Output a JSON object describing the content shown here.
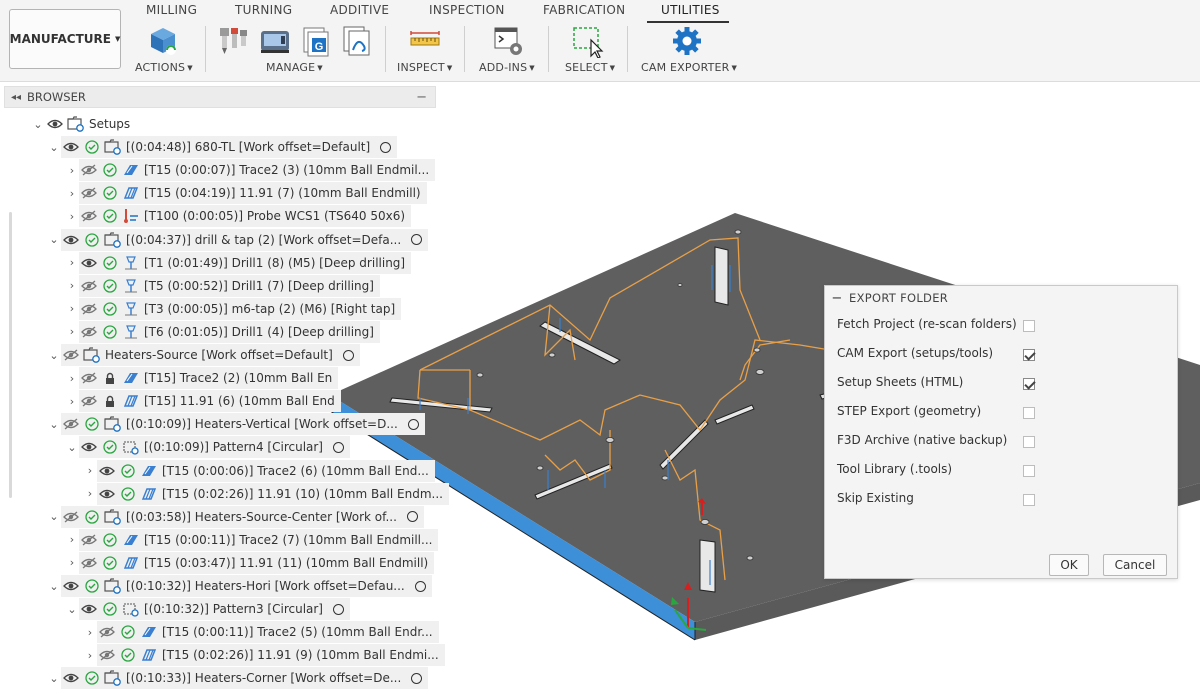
{
  "ribbon": {
    "workspace": "MANUFACTURE",
    "tabs": [
      "MILLING",
      "TURNING",
      "ADDITIVE",
      "INSPECTION",
      "FABRICATION",
      "UTILITIES"
    ],
    "active_tab": "UTILITIES",
    "groups": {
      "actions": "ACTIONS",
      "manage": "MANAGE",
      "inspect": "INSPECT",
      "addins": "ADD-INS",
      "select": "SELECT",
      "cam_exporter": "CAM EXPORTER"
    },
    "accent": "#1f73c4"
  },
  "browser": {
    "title": "BROWSER",
    "rows": [
      {
        "label": "Setups"
      },
      {
        "label": "[(0:04:48)] 680-TL [Work offset=Default]"
      },
      {
        "label": "[T15 (0:00:07)] Trace2 (3) (10mm Ball Endmil..."
      },
      {
        "label": "[T15 (0:04:19)] 11.91 (7) (10mm Ball Endmill)"
      },
      {
        "label": "[T100 (0:00:05)] Probe WCS1 (TS640 50x6)"
      },
      {
        "label": "[(0:04:37)] drill & tap (2) [Work offset=Defa..."
      },
      {
        "label": "[T1 (0:01:49)] Drill1 (8) (M5) [Deep drilling]"
      },
      {
        "label": "[T5 (0:00:52)] Drill1 (7) [Deep drilling]"
      },
      {
        "label": "[T3 (0:00:05)] m6-tap (2) (M6) [Right tap]"
      },
      {
        "label": "[T6 (0:01:05)] Drill1 (4) [Deep drilling]"
      },
      {
        "label": "Heaters-Source [Work offset=Default]"
      },
      {
        "label": "[T15] Trace2 (2) (10mm Ball En"
      },
      {
        "label": "[T15] 11.91 (6) (10mm Ball End"
      },
      {
        "label": "[(0:10:09)] Heaters-Vertical [Work offset=D..."
      },
      {
        "label": "[(0:10:09)] Pattern4 [Circular]"
      },
      {
        "label": "[T15 (0:00:06)] Trace2 (6) (10mm Ball End..."
      },
      {
        "label": "[T15 (0:02:26)] 11.91 (10) (10mm Ball Endm..."
      },
      {
        "label": "[(0:03:58)] Heaters-Source-Center [Work of..."
      },
      {
        "label": "[T15 (0:00:11)] Trace2 (7) (10mm Ball Endmill..."
      },
      {
        "label": "[T15 (0:03:47)] 11.91 (11) (10mm Ball Endmill)"
      },
      {
        "label": "[(0:10:32)] Heaters-Hori [Work offset=Defau..."
      },
      {
        "label": "[(0:10:32)] Pattern3 [Circular]"
      },
      {
        "label": "[T15 (0:00:11)] Trace2 (5) (10mm Ball Endr..."
      },
      {
        "label": "[T15 (0:02:26)] 11.91 (9) (10mm Ball Endmi..."
      },
      {
        "label": "[(0:10:33)] Heaters-Corner [Work offset=De..."
      }
    ]
  },
  "dialog": {
    "title": "EXPORT FOLDER",
    "options": [
      {
        "label": "Fetch Project (re-scan folders)",
        "checked": false
      },
      {
        "label": "CAM Export (setups/tools)",
        "checked": true
      },
      {
        "label": "Setup Sheets (HTML)",
        "checked": true
      },
      {
        "label": "STEP Export (geometry)",
        "checked": false
      },
      {
        "label": "F3D Archive (native backup)",
        "checked": false
      },
      {
        "label": "Tool Library (.tools)",
        "checked": false
      },
      {
        "label": "Skip Existing",
        "checked": false
      }
    ],
    "ok_label": "OK",
    "cancel_label": "Cancel"
  }
}
